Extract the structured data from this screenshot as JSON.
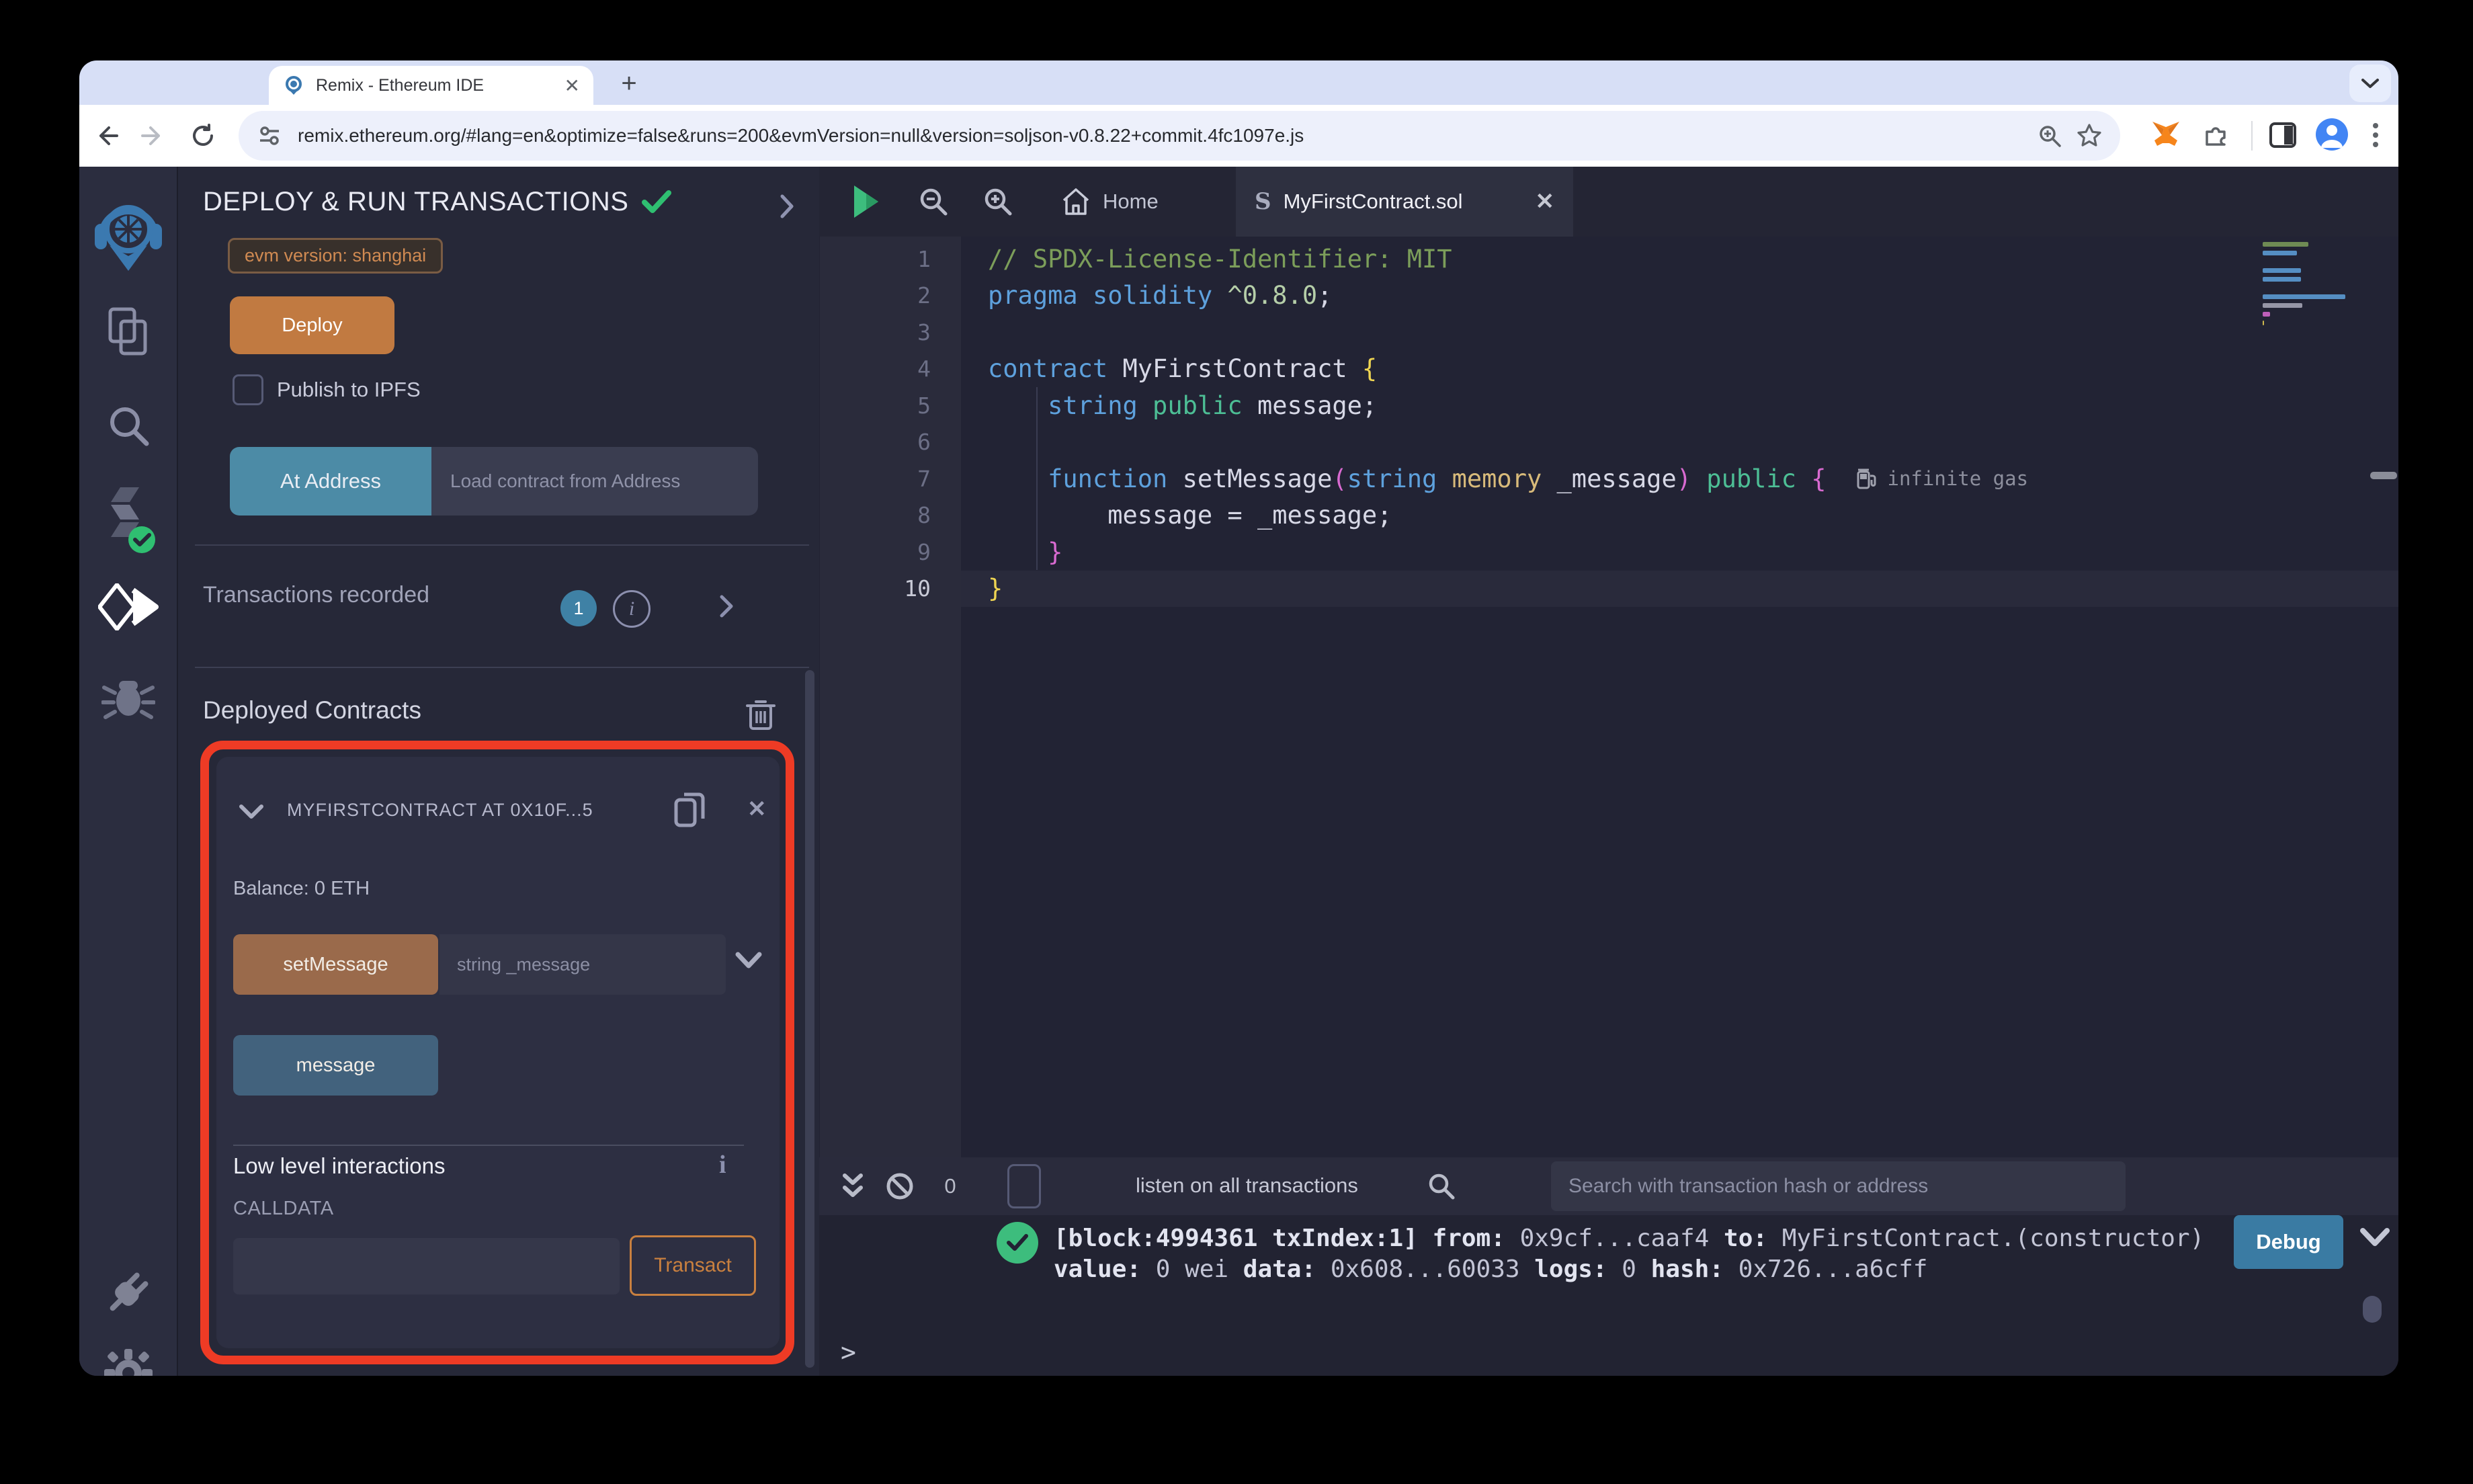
{
  "browser": {
    "tab_title": "Remix - Ethereum IDE",
    "new_tab_label": "+",
    "url": "remix.ethereum.org/#lang=en&optimize=false&runs=200&evmVersion=null&version=soljson-v0.8.22+commit.4fc1097e.js"
  },
  "run_panel": {
    "title": "DEPLOY & RUN TRANSACTIONS",
    "evm_badge": "evm version: shanghai",
    "deploy_label": "Deploy",
    "publish_label": "Publish to IPFS",
    "at_address_label": "At Address",
    "at_address_placeholder": "Load contract from Address",
    "transactions_recorded_label": "Transactions recorded",
    "transactions_count": "1",
    "deployed_contracts_label": "Deployed Contracts",
    "contract": {
      "header": "MYFIRSTCONTRACT AT 0X10F...5",
      "balance": "Balance: 0 ETH",
      "set_message_label": "setMessage",
      "set_message_placeholder": "string _message",
      "message_label": "message",
      "low_level_label": "Low level interactions",
      "info_glyph": "i",
      "calldata_label": "CALLDATA",
      "transact_label": "Transact"
    }
  },
  "editor": {
    "home_tab_label": "Home",
    "file_tab_label": "MyFirstContract.sol",
    "file_tab_icon_glyph": "S",
    "gas_annotation": "infinite gas",
    "lines": [
      {
        "n": "1",
        "tokens": [
          {
            "c": "com",
            "t": "// SPDX-License-Identifier: MIT"
          }
        ]
      },
      {
        "n": "2",
        "tokens": [
          {
            "c": "kw",
            "t": "pragma"
          },
          {
            "c": "pl",
            "t": " "
          },
          {
            "c": "kw",
            "t": "solidity"
          },
          {
            "c": "pl",
            "t": " "
          },
          {
            "c": "num",
            "t": "^0.8.0"
          },
          {
            "c": "pl",
            "t": ";"
          }
        ]
      },
      {
        "n": "3",
        "tokens": []
      },
      {
        "n": "4",
        "tokens": [
          {
            "c": "kw",
            "t": "contract"
          },
          {
            "c": "pl",
            "t": " MyFirstContract "
          },
          {
            "c": "b1",
            "t": "{"
          }
        ]
      },
      {
        "n": "5",
        "tokens": [
          {
            "c": "pl",
            "t": "    "
          },
          {
            "c": "kw",
            "t": "string"
          },
          {
            "c": "pl",
            "t": " "
          },
          {
            "c": "mod",
            "t": "public"
          },
          {
            "c": "pl",
            "t": " message;"
          }
        ]
      },
      {
        "n": "6",
        "tokens": []
      },
      {
        "n": "7",
        "gas": true,
        "tokens": [
          {
            "c": "pl",
            "t": "    "
          },
          {
            "c": "kw",
            "t": "function"
          },
          {
            "c": "pl",
            "t": " setMessage"
          },
          {
            "c": "b2",
            "t": "("
          },
          {
            "c": "kw",
            "t": "string"
          },
          {
            "c": "pl",
            "t": " "
          },
          {
            "c": "mem",
            "t": "memory"
          },
          {
            "c": "pl",
            "t": " _message"
          },
          {
            "c": "b2",
            "t": ")"
          },
          {
            "c": "pl",
            "t": " "
          },
          {
            "c": "mod",
            "t": "public"
          },
          {
            "c": "pl",
            "t": " "
          },
          {
            "c": "b2",
            "t": "{"
          }
        ]
      },
      {
        "n": "8",
        "tokens": [
          {
            "c": "pl",
            "t": "        message = _message;"
          }
        ]
      },
      {
        "n": "9",
        "tokens": [
          {
            "c": "pl",
            "t": "    "
          },
          {
            "c": "b2",
            "t": "}"
          }
        ]
      },
      {
        "n": "10",
        "active": true,
        "tokens": [
          {
            "c": "b1",
            "t": "}"
          }
        ]
      }
    ]
  },
  "terminal": {
    "listen_count": "0",
    "listen_label": "listen on all transactions",
    "search_placeholder": "Search with transaction hash or address",
    "log": {
      "line1": [
        {
          "t": "[block:4994361 txIndex:1] ",
          "b": true
        },
        {
          "t": "from: ",
          "b": true
        },
        {
          "t": "0x9cf...caaf4 "
        },
        {
          "t": "to: ",
          "b": true
        },
        {
          "t": "MyFirstContract.(constructor) "
        }
      ],
      "line2": [
        {
          "t": "value: ",
          "b": true
        },
        {
          "t": "0 wei "
        },
        {
          "t": "data: ",
          "b": true
        },
        {
          "t": "0x608...60033 "
        },
        {
          "t": "logs: ",
          "b": true
        },
        {
          "t": "0 "
        },
        {
          "t": "hash: ",
          "b": true
        },
        {
          "t": "0x726...a6cff"
        }
      ]
    },
    "debug_label": "Debug",
    "prompt": ">"
  },
  "colors": {
    "accent_orange": "#c17a41",
    "warn_brown": "#9a6a4b",
    "info_blue": "#4c8ba6",
    "steel_blue": "#42627d",
    "debug_blue": "#3a7ba3",
    "badge_blue": "#3f81a5",
    "success_green": "#3dbd7d",
    "check_green": "#2fbf71",
    "highlight_red": "#ee3b25",
    "transact_orange": "#c9803f",
    "evm_text": "#d08a52",
    "token_comment": "#7c9e5a",
    "token_keyword": "#5ea1dd",
    "token_modifier": "#4dbe95",
    "token_memory": "#d8ba7a",
    "token_bracket1": "#eed452",
    "token_bracket2": "#d96ad1"
  }
}
